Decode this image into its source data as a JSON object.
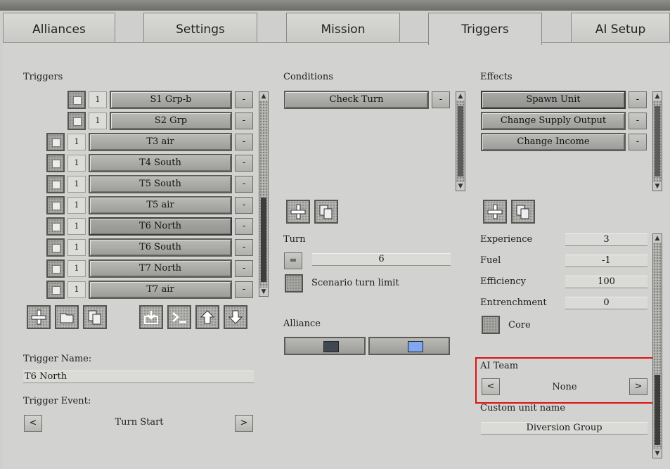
{
  "tabs": [
    "Alliances",
    "Settings",
    "Mission",
    "Triggers",
    "AI Setup"
  ],
  "triggers": {
    "title": "Triggers",
    "rows": [
      {
        "num": "1",
        "label": "S1 Grp-b",
        "remove": "-"
      },
      {
        "num": "1",
        "label": "S2 Grp",
        "remove": "-"
      },
      {
        "num": "1",
        "label": "T3  air",
        "remove": "-"
      },
      {
        "num": "1",
        "label": "T4 South",
        "remove": "-"
      },
      {
        "num": "1",
        "label": "T5 South",
        "remove": "-"
      },
      {
        "num": "1",
        "label": "T5  air",
        "remove": "-"
      },
      {
        "num": "1",
        "label": "T6 North",
        "remove": "-"
      },
      {
        "num": "1",
        "label": "T6 South",
        "remove": "-"
      },
      {
        "num": "1",
        "label": "T7 North",
        "remove": "-"
      },
      {
        "num": "1",
        "label": "T7  air",
        "remove": "-"
      }
    ],
    "toolbar_icons": [
      "add-icon",
      "folder-icon",
      "copy-icon",
      "import-icon",
      "console-icon",
      "arrow-up-icon",
      "arrow-down-icon"
    ],
    "name_label": "Trigger Name:",
    "name_value": "T6 North",
    "event_label": "Trigger Event:",
    "event_prev": "<",
    "event_value": "Turn Start",
    "event_next": ">"
  },
  "conditions": {
    "title": "Conditions",
    "items": [
      {
        "label": "Check Turn",
        "remove": "-"
      }
    ],
    "turn_label": "Turn",
    "turn_op": "=",
    "turn_value": "6",
    "limit_label": "Scenario turn limit",
    "alliance_label": "Alliance",
    "alliance_colors": [
      "#3f4850",
      "#7fa8ee"
    ]
  },
  "effects": {
    "title": "Effects",
    "items": [
      {
        "label": "Spawn Unit",
        "remove": "-"
      },
      {
        "label": "Change Supply Output",
        "remove": "-"
      },
      {
        "label": "Change Income",
        "remove": "-"
      }
    ],
    "experience_label": "Experience",
    "experience_value": "3",
    "fuel_label": "Fuel",
    "fuel_value": "-1",
    "efficiency_label": "Efficiency",
    "efficiency_value": "100",
    "entrenchment_label": "Entrenchment",
    "entrenchment_value": "0",
    "core_label": "Core",
    "ai_team_label": "AI Team",
    "ai_team_prev": "<",
    "ai_team_value": "None",
    "ai_team_next": ">",
    "custom_name_label": "Custom unit name",
    "custom_name_value": "Diversion Group"
  }
}
